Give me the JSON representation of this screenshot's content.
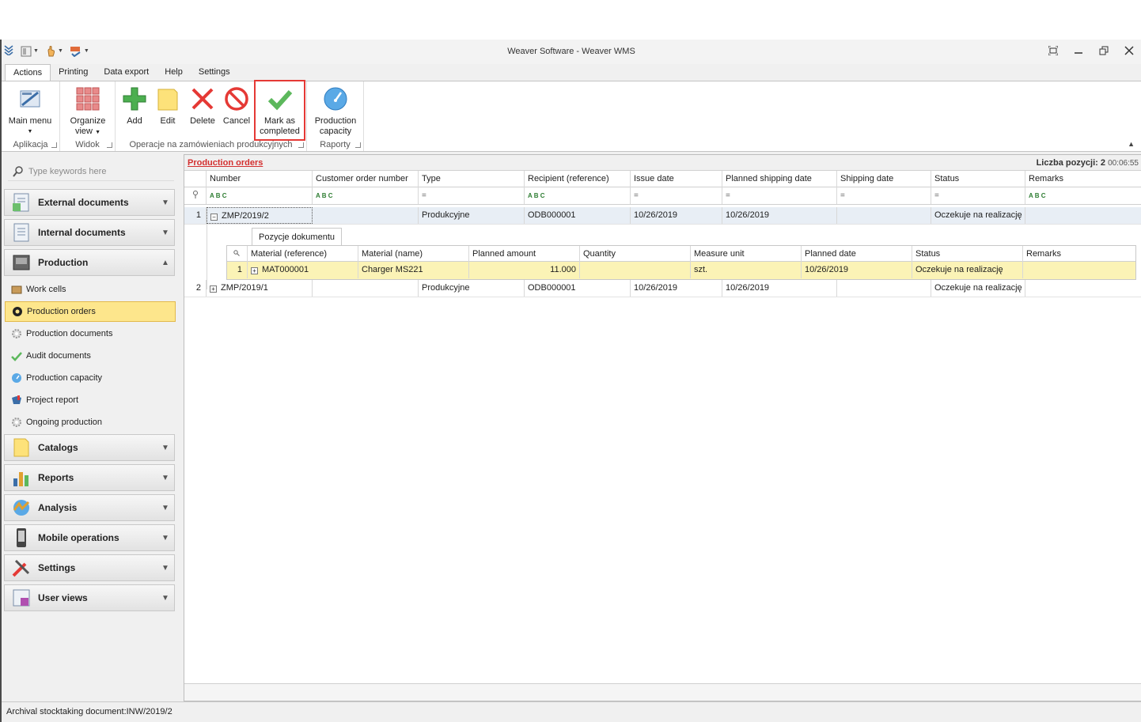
{
  "window": {
    "title": "Weaver Software - Weaver WMS"
  },
  "ribbon_tabs": [
    "Actions",
    "Printing",
    "Data export",
    "Help",
    "Settings"
  ],
  "ribbon": {
    "groups": {
      "aplikacja": "Aplikacja",
      "widok": "Widok",
      "operacje": "Operacje na zamówieniach produkcyjnych",
      "raporty": "Raporty"
    },
    "buttons": {
      "main_menu": "Main menu",
      "organize_view_1": "Organize",
      "organize_view_2": "view",
      "add": "Add",
      "edit": "Edit",
      "delete": "Delete",
      "cancel": "Cancel",
      "mark_completed_1": "Mark as",
      "mark_completed_2": "completed",
      "production_capacity_1": "Production",
      "production_capacity_2": "capacity"
    }
  },
  "sidebar": {
    "search_placeholder": "Type keywords here",
    "groups": {
      "external": "External documents",
      "internal": "Internal documents",
      "production": "Production",
      "catalogs": "Catalogs",
      "reports": "Reports",
      "analysis": "Analysis",
      "mobile": "Mobile operations",
      "settings": "Settings",
      "user_views": "User views"
    },
    "production_items": [
      "Work cells",
      "Production orders",
      "Production documents",
      "Audit documents",
      "Production capacity",
      "Project report",
      "Ongoing production"
    ]
  },
  "main": {
    "caption": "Production orders",
    "count": "Liczba pozycji: 2",
    "timer": "00:06:55",
    "columns": [
      "Number",
      "Customer order number",
      "Type",
      "Recipient (reference)",
      "Issue date",
      "Planned shipping date",
      "Shipping date",
      "Status",
      "Remarks"
    ],
    "rows": [
      {
        "n": "1",
        "number": "ZMP/2019/2",
        "customer": "",
        "type": "Produkcyjne",
        "recipient": "ODB000001",
        "issue": "10/26/2019",
        "planned": "10/26/2019",
        "shipping": "",
        "status": "Oczekuje na realizację",
        "remarks": ""
      },
      {
        "n": "2",
        "number": "ZMP/2019/1",
        "customer": "",
        "type": "Produkcyjne",
        "recipient": "ODB000001",
        "issue": "10/26/2019",
        "planned": "10/26/2019",
        "shipping": "",
        "status": "Oczekuje na realizację",
        "remarks": ""
      }
    ],
    "detail": {
      "tab": "Pozycje dokumentu",
      "columns": [
        "Material (reference)",
        "Material (name)",
        "Planned amount",
        "Quantity",
        "Measure unit",
        "Planned date",
        "Status",
        "Remarks"
      ],
      "row": {
        "n": "1",
        "material_ref": "MAT000001",
        "material_name": "Charger MS221",
        "planned_amount": "11.000",
        "quantity": "",
        "unit": "szt.",
        "planned_date": "10/26/2019",
        "status": "Oczekuje na realizację",
        "remarks": ""
      }
    }
  },
  "status_bar": "Archival stocktaking document:INW/2019/2",
  "colors": {
    "accent_red": "#d32f2f",
    "selection_yellow": "#fde68c",
    "detail_row": "#fbf3b6"
  }
}
